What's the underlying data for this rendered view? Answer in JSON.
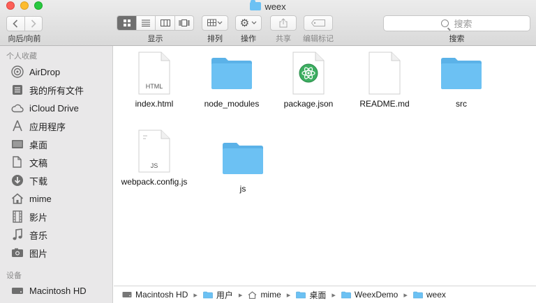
{
  "window": {
    "title": "weex",
    "title_icon": "folder-icon"
  },
  "toolbar": {
    "nav_label": "向后/向前",
    "view_label": "显示",
    "arrange_label": "排列",
    "action_label": "操作",
    "share_label": "共享",
    "tag_label": "编辑标记",
    "search_placeholder": "搜索",
    "search_label": "搜索"
  },
  "sidebar": {
    "favorites_header": "个人收藏",
    "favorites": [
      {
        "label": "AirDrop",
        "icon": "airdrop-icon"
      },
      {
        "label": "我的所有文件",
        "icon": "all-files-icon"
      },
      {
        "label": "iCloud Drive",
        "icon": "cloud-icon"
      },
      {
        "label": "应用程序",
        "icon": "applications-icon"
      },
      {
        "label": "桌面",
        "icon": "desktop-icon"
      },
      {
        "label": "文稿",
        "icon": "documents-icon"
      },
      {
        "label": "下载",
        "icon": "downloads-icon"
      },
      {
        "label": "mime",
        "icon": "home-icon"
      },
      {
        "label": "影片",
        "icon": "movies-icon"
      },
      {
        "label": "音乐",
        "icon": "music-icon"
      },
      {
        "label": "图片",
        "icon": "pictures-icon"
      }
    ],
    "devices_header": "设备",
    "devices": [
      {
        "label": "Macintosh HD",
        "icon": "hard-drive-icon"
      }
    ]
  },
  "files": [
    {
      "name": "index.html",
      "kind": "document",
      "badge": "HTML"
    },
    {
      "name": "node_modules",
      "kind": "folder"
    },
    {
      "name": "package.json",
      "kind": "atom-document"
    },
    {
      "name": "README.md",
      "kind": "document",
      "badge": ""
    },
    {
      "name": "src",
      "kind": "folder"
    },
    {
      "name": "webpack.config.js",
      "kind": "document",
      "badge": "JS"
    },
    {
      "name": "js",
      "kind": "folder"
    }
  ],
  "pathbar": [
    {
      "label": "Macintosh HD",
      "icon": "hard-drive-icon"
    },
    {
      "label": "用户",
      "icon": "folder-icon"
    },
    {
      "label": "mime",
      "icon": "home-icon"
    },
    {
      "label": "桌面",
      "icon": "folder-icon"
    },
    {
      "label": "WeexDemo",
      "icon": "folder-icon"
    },
    {
      "label": "weex",
      "icon": "folder-icon"
    }
  ],
  "colors": {
    "folder": "#6cc1f3",
    "folder_dark": "#5bb2e8",
    "close": "#fc5f57",
    "minimize": "#fdbc2e",
    "maximize": "#28c840"
  }
}
